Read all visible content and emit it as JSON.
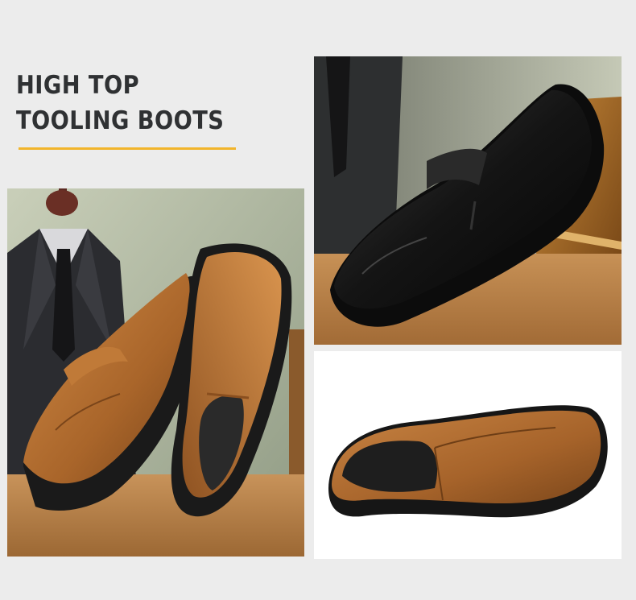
{
  "headline": {
    "lines": [
      "HIGH TOP",
      "TOOLING BOOTS"
    ]
  },
  "colors": {
    "background": "#ececec",
    "headline_text": "#2f3133",
    "accent_underline": "#f2b52b",
    "brown_leather": "#b06a2a",
    "black_leather": "#141414",
    "sole": "#1b1b1b"
  },
  "photos": [
    {
      "name": "brown-shoe-pair-photo",
      "subject": "pair of brown leather slip-on shoes with mannequin in suit"
    },
    {
      "name": "black-shoe-photo",
      "subject": "black leather slip-on shoe on wooden box"
    },
    {
      "name": "brown-shoe-single-photo",
      "subject": "single brown leather slip-on shoe on white background"
    }
  ]
}
